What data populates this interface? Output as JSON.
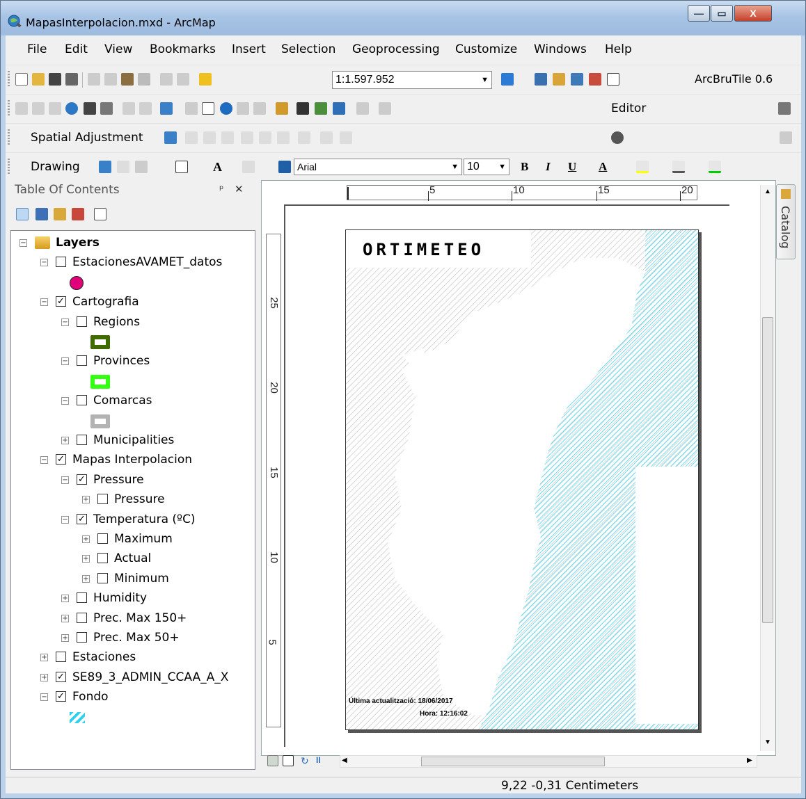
{
  "window": {
    "title": "MapasInterpolacion.mxd - ArcMap",
    "controls": {
      "minimize": "—",
      "maximize": "▭",
      "close": "X"
    }
  },
  "menu": [
    "File",
    "Edit",
    "View",
    "Bookmarks",
    "Insert",
    "Selection",
    "Geoprocessing",
    "Customize",
    "Windows",
    "Help"
  ],
  "toolbar": {
    "scale": "1:1.597.952",
    "arcbrutile": "ArcBruTile 0.6",
    "editor": "Editor",
    "spatial_adjustment": "Spatial Adjustment",
    "drawing": "Drawing",
    "font": "Arial",
    "font_size": "10",
    "bold": "B",
    "italic": "I",
    "underline": "U",
    "text_color_glyph": "A"
  },
  "toc": {
    "header": "Table Of Contents",
    "pin": "ᵖ",
    "close": "✕",
    "layers": [
      {
        "label": "Layers",
        "level": 0,
        "expanded": true,
        "checkbox": null,
        "bold": true,
        "icon": "layers-icon"
      },
      {
        "label": "EstacionesAVAMET_datos",
        "level": 1,
        "expanded": true,
        "checkbox": false
      },
      {
        "symbol": "point-magenta",
        "level": 1
      },
      {
        "label": "Cartografia",
        "level": 1,
        "expanded": true,
        "checkbox": true
      },
      {
        "label": "Regions",
        "level": 2,
        "expanded": true,
        "checkbox": false
      },
      {
        "symbol": "poly-darkgreen",
        "level": 2
      },
      {
        "label": "Provinces",
        "level": 2,
        "expanded": true,
        "checkbox": false
      },
      {
        "symbol": "poly-green",
        "level": 2
      },
      {
        "label": "Comarcas",
        "level": 2,
        "expanded": true,
        "checkbox": false
      },
      {
        "symbol": "poly-gray",
        "level": 2
      },
      {
        "label": "Municipalities",
        "level": 2,
        "expanded": false,
        "checkbox": false
      },
      {
        "label": "Mapas Interpolacion",
        "level": 1,
        "expanded": true,
        "checkbox": true
      },
      {
        "label": "Pressure",
        "level": 2,
        "expanded": true,
        "checkbox": true
      },
      {
        "label": "Pressure",
        "level": 3,
        "expanded": false,
        "checkbox": false
      },
      {
        "label": "Temperatura (ºC)",
        "level": 2,
        "expanded": true,
        "checkbox": true
      },
      {
        "label": "Maximum",
        "level": 3,
        "expanded": false,
        "checkbox": false
      },
      {
        "label": "Actual",
        "level": 3,
        "expanded": false,
        "checkbox": false
      },
      {
        "label": "Minimum",
        "level": 3,
        "expanded": false,
        "checkbox": false
      },
      {
        "label": "Humidity",
        "level": 2,
        "expanded": false,
        "checkbox": false
      },
      {
        "label": "Prec. Max 150+",
        "level": 2,
        "expanded": false,
        "checkbox": false
      },
      {
        "label": "Prec. Max 50+",
        "level": 2,
        "expanded": false,
        "checkbox": false
      },
      {
        "label": "Estaciones",
        "level": 1,
        "expanded": false,
        "checkbox": false
      },
      {
        "label": "SE89_3_ADMIN_CCAA_A_X",
        "level": 1,
        "expanded": false,
        "checkbox": true
      },
      {
        "label": "Fondo",
        "level": 1,
        "expanded": true,
        "checkbox": true
      },
      {
        "symbol": "hatch-cyan",
        "level": 1
      }
    ]
  },
  "layout": {
    "hruler_labels": [
      "5",
      "10",
      "15",
      "20"
    ],
    "vruler_labels": [
      "25",
      "20",
      "15",
      "10",
      "5"
    ],
    "logo": "ORTIMETEO",
    "footnote_date": "Última actualització: 18/06/2017",
    "footnote_time": "Hora: 12:16:02"
  },
  "catalog_tab": "Catalog",
  "status": {
    "coords": "9,22  -0,31 Centimeters"
  },
  "colors": {
    "magenta": "#e0007a",
    "darkgreen": "#3f6b00",
    "green": "#33ff11",
    "gray": "#b3b3b3",
    "cyan": "#2bd2f0"
  }
}
